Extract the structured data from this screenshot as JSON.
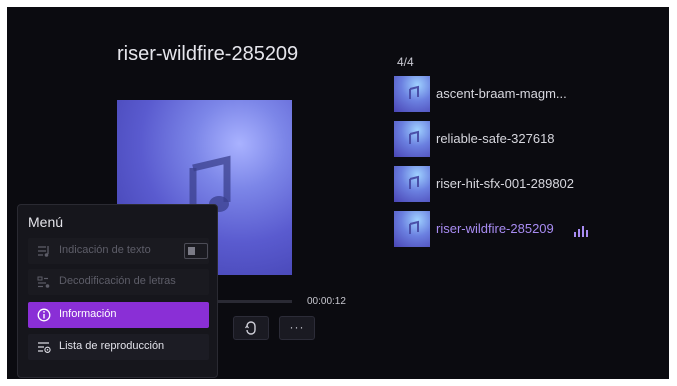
{
  "now_playing": {
    "title": "riser-wildfire-285209",
    "time": "00:00:12",
    "progress": 0.38
  },
  "playlist": {
    "counter": "4/4",
    "items": [
      {
        "label": "ascent-braam-magm..."
      },
      {
        "label": "reliable-safe-327618"
      },
      {
        "label": "riser-hit-sfx-001-289802"
      },
      {
        "label": "riser-wildfire-285209",
        "active": true
      }
    ]
  },
  "controls": {
    "repeat_icon": "repeat-icon",
    "more_label": "···"
  },
  "menu": {
    "title": "Menú",
    "items": [
      {
        "label": "Indicación de texto",
        "icon": "lyrics-icon",
        "state": "disabled",
        "toggle": "off"
      },
      {
        "label": "Decodificación de letras",
        "icon": "decode-icon",
        "state": "disabled"
      },
      {
        "label": "Información",
        "icon": "info-icon",
        "state": "focused"
      },
      {
        "label": "Lista de reproducción",
        "icon": "playlist-icon",
        "state": "normal"
      }
    ]
  },
  "colors": {
    "accent": "#8a2fd6",
    "active_track": "#a88cf2",
    "background": "#0b0b10"
  }
}
